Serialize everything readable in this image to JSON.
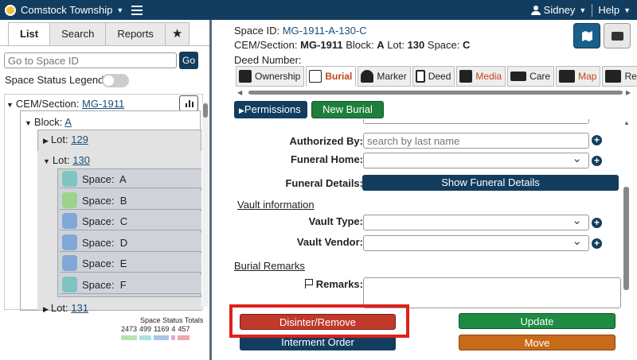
{
  "topbar": {
    "app_title": "Comstock Township",
    "user": "Sidney",
    "help": "Help"
  },
  "left": {
    "tabs": [
      "List",
      "Search",
      "Reports",
      "★"
    ],
    "go_input_placeholder": "Go to Space ID",
    "go_label": "Go",
    "legend_label": "Space Status Legend:",
    "tree": {
      "cem_label": "CEM/Section:",
      "cem_value": "MG-1911",
      "block_label": "Block:",
      "block_value": "A",
      "lot_label": "Lot:",
      "lots": [
        "129",
        "130",
        "131"
      ],
      "space_label": "Space:",
      "spaces": [
        {
          "name": "A",
          "color": "#7fc4c0"
        },
        {
          "name": "B",
          "color": "#9bd48a"
        },
        {
          "name": "C",
          "color": "#7fa8d6"
        },
        {
          "name": "D",
          "color": "#7fa8d6"
        },
        {
          "name": "E",
          "color": "#7fa8d6"
        },
        {
          "name": "F",
          "color": "#7fc4c0"
        }
      ]
    },
    "totals_title": "Space Status Totals",
    "totals": [
      {
        "value": "2473",
        "color": "#b7e3b0"
      },
      {
        "value": "499",
        "color": "#a8e0e4"
      },
      {
        "value": "1169",
        "color": "#a7c5ea"
      },
      {
        "value": "4",
        "color": "#e5a5e0"
      },
      {
        "value": "457",
        "color": "#f0a8a8"
      }
    ]
  },
  "right": {
    "space_id_label": "Space ID:",
    "space_id": "MG-1911-A-130-C",
    "cem_label": "CEM/Section:",
    "cem": "MG-1911",
    "block_label": "Block:",
    "block": "A",
    "lot_label": "Lot:",
    "lot": "130",
    "space_label": "Space:",
    "space": "C",
    "deed_label": "Deed Number:",
    "tabs": [
      "Ownership",
      "Burial",
      "Marker",
      "Deed",
      "Media",
      "Care",
      "Map",
      "Rep"
    ],
    "permissions": "Permissions",
    "new_burial": "New Burial",
    "form": {
      "authorized_by": "Authorized By:",
      "authorized_placeholder": "search by last name",
      "funeral_home": "Funeral Home:",
      "funeral_details": "Funeral Details:",
      "show_funeral_details": "Show Funeral Details",
      "vault_info": "Vault information",
      "vault_type": "Vault Type:",
      "vault_vendor": "Vault Vendor:",
      "burial_remarks": "Burial Remarks",
      "remarks": "Remarks:"
    },
    "buttons": {
      "disinter": "Disinter/Remove",
      "update": "Update",
      "interment_order": "Interment Order",
      "move": "Move"
    }
  }
}
